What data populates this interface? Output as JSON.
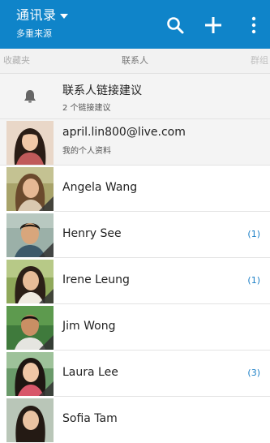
{
  "header": {
    "title": "通讯录",
    "subtitle": "多重来源",
    "accent": "#0f84c9"
  },
  "tabs": {
    "left": "收藏夹",
    "center": "联系人",
    "right": "群组"
  },
  "suggestion": {
    "title": "联系人链接建议",
    "subtitle": "2 个链接建议",
    "icon": "bell-icon"
  },
  "profile": {
    "email": "april.lin800@live.com",
    "label": "我的个人资料"
  },
  "contacts": [
    {
      "name": "Angela Wang",
      "badge": ""
    },
    {
      "name": "Henry See",
      "badge": "(1)"
    },
    {
      "name": "Irene Leung",
      "badge": "(1)"
    },
    {
      "name": "Jim Wong",
      "badge": ""
    },
    {
      "name": "Laura Lee",
      "badge": "(3)"
    },
    {
      "name": "Sofia Tam",
      "badge": ""
    }
  ]
}
